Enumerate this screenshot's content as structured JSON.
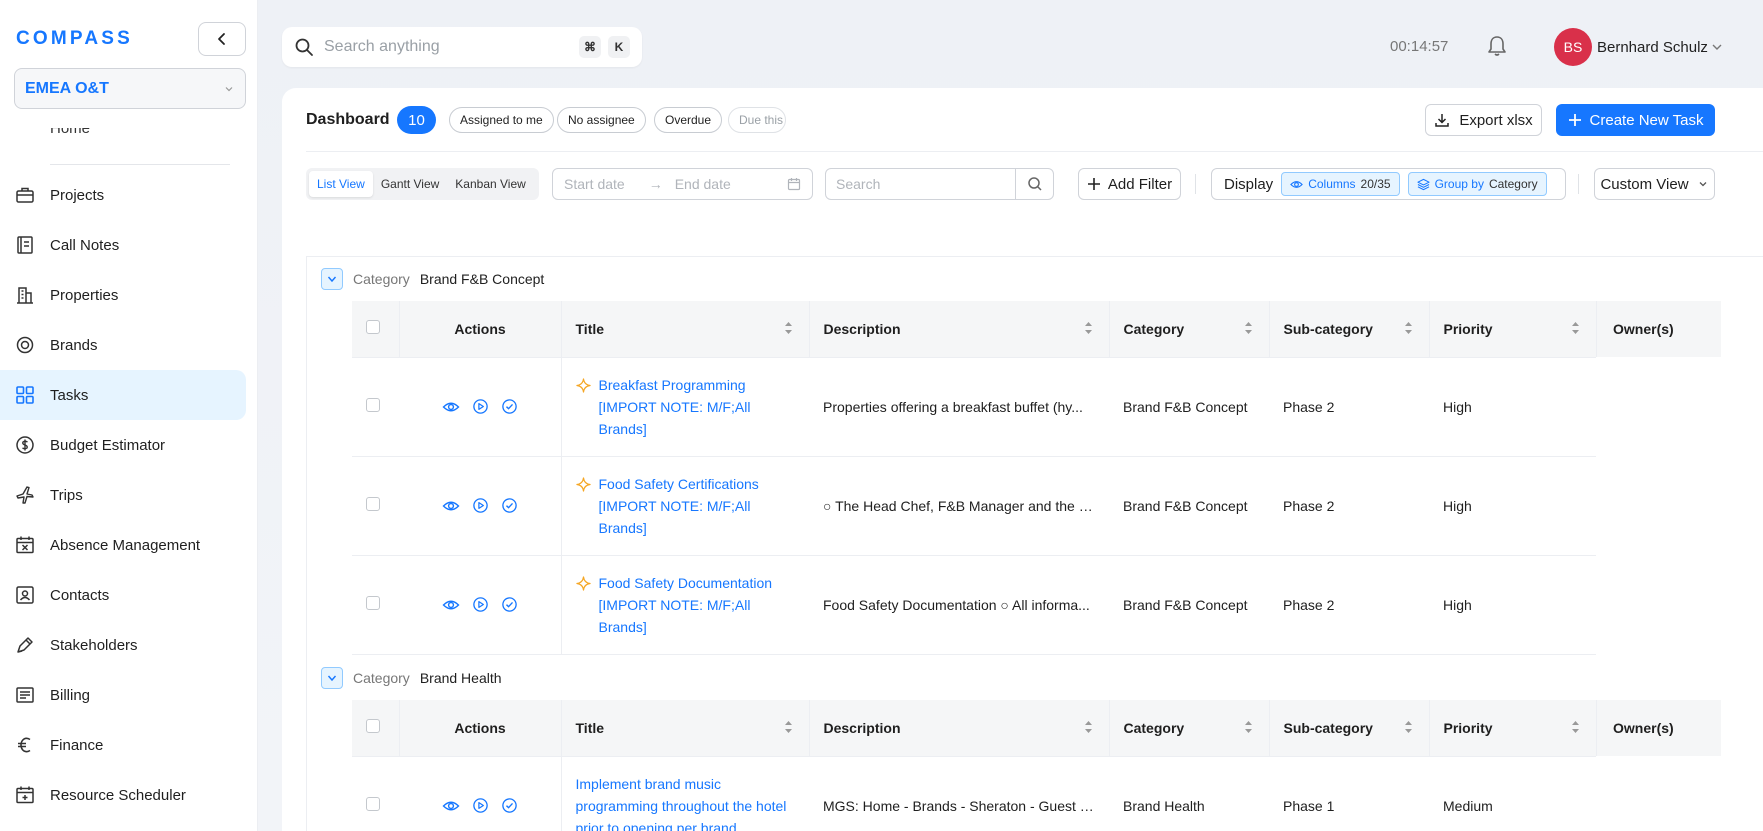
{
  "sidebar": {
    "logo": "COMPASS",
    "workspace": "EMEA O&T",
    "partial_item": "Home",
    "items": [
      {
        "label": "Projects",
        "icon": "briefcase-icon"
      },
      {
        "label": "Call Notes",
        "icon": "notebook-icon"
      },
      {
        "label": "Properties",
        "icon": "building-icon"
      },
      {
        "label": "Brands",
        "icon": "badge-icon"
      },
      {
        "label": "Tasks",
        "icon": "grid-icon",
        "active": true
      },
      {
        "label": "Budget Estimator",
        "icon": "dollar-icon"
      },
      {
        "label": "Trips",
        "icon": "plane-icon"
      },
      {
        "label": "Absence Management",
        "icon": "calendar-x-icon"
      },
      {
        "label": "Contacts",
        "icon": "contact-card-icon"
      },
      {
        "label": "Stakeholders",
        "icon": "pen-icon"
      },
      {
        "label": "Billing",
        "icon": "receipt-icon"
      },
      {
        "label": "Finance",
        "icon": "euro-icon"
      },
      {
        "label": "Resource Scheduler",
        "icon": "calendar-plus-icon"
      }
    ]
  },
  "topbar": {
    "search_placeholder": "Search anything",
    "shortcut_cmd": "⌘",
    "shortcut_key": "K",
    "timer": "00:14:57",
    "user_initials": "BS",
    "user_name": "Bernhard Schulz"
  },
  "dashboard": {
    "title": "Dashboard",
    "count": "10",
    "chips": [
      "Assigned to me",
      "No assignee",
      "Overdue",
      "Due this"
    ],
    "export_label": "Export xlsx",
    "create_label": "Create New Task"
  },
  "toolbar": {
    "views": [
      "List View",
      "Gantt View",
      "Kanban View"
    ],
    "start_placeholder": "Start date",
    "end_placeholder": "End date",
    "search_placeholder": "Search",
    "add_filter": "Add Filter",
    "display_label": "Display",
    "columns_label": "Columns",
    "columns_value": "20/35",
    "groupby_label": "Group by",
    "groupby_value": "Category",
    "custom_view": "Custom View"
  },
  "table": {
    "headers": [
      "Actions",
      "Title",
      "Description",
      "Category",
      "Sub-category",
      "Priority",
      "Owner(s)"
    ]
  },
  "groups": [
    {
      "key": "Category",
      "value": "Brand F&B Concept",
      "rows": [
        {
          "title": "Breakfast Programming [IMPORT NOTE: M/F;All Brands]",
          "description": "Properties offering a breakfast buffet (hy...",
          "category": "Brand F&B Concept",
          "subcategory": "Phase 2",
          "priority": "High",
          "starred": true
        },
        {
          "title": "Food Safety Certifications [IMPORT NOTE: M/F;All Brands]",
          "description": "○ The Head Chef, F&B Manager and the C...",
          "category": "Brand F&B Concept",
          "subcategory": "Phase 2",
          "priority": "High",
          "starred": true
        },
        {
          "title": "Food Safety Documentation [IMPORT NOTE: M/F;All Brands]",
          "description": "Food Safety Documentation ○ All informa...",
          "category": "Brand F&B Concept",
          "subcategory": "Phase 2",
          "priority": "High",
          "starred": true
        }
      ]
    },
    {
      "key": "Category",
      "value": "Brand Health",
      "rows": [
        {
          "title": "Implement brand music programming throughout the hotel prior to opening per brand",
          "description": "MGS: Home - Brands - Sheraton - Guest E...",
          "category": "Brand Health",
          "subcategory": "Phase 1",
          "priority": "Medium",
          "starred": false
        }
      ]
    }
  ],
  "colors": {
    "accent": "#1677ff",
    "avatar": "#d9304a",
    "star": "#f5a623"
  }
}
